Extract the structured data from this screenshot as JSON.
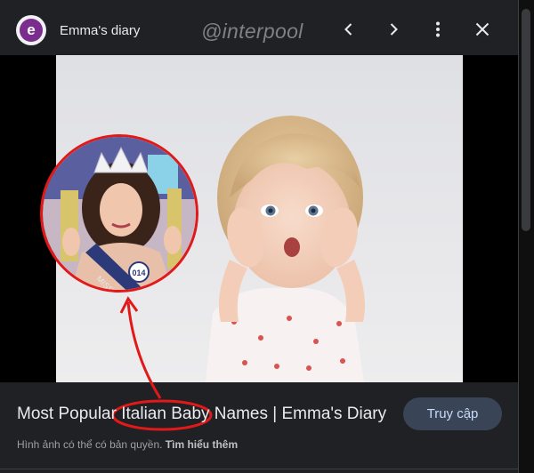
{
  "header": {
    "logo_letter": "e",
    "site_name": "Emma's diary",
    "watermark": "@interpool",
    "icons": [
      "chevron-left-icon",
      "chevron-right-icon",
      "more-vert-icon",
      "close-icon"
    ]
  },
  "inset_photo": {
    "sash_text": "MISS",
    "badge_number": "014"
  },
  "result": {
    "title_before": "Most Popular ",
    "title_highlight": "Italian Baby",
    "title_after": " Names | Emma's Diary",
    "visit_button": "Truy cập",
    "copyright_text": "Hình ảnh có thể có bản quyền.",
    "learn_more": "Tìm hiểu thêm"
  },
  "colors": {
    "background": "#202124",
    "annotation_red": "#e11919",
    "logo_purple": "#7b2d8e",
    "button_bg": "#394457",
    "button_text": "#c8dcf8"
  }
}
